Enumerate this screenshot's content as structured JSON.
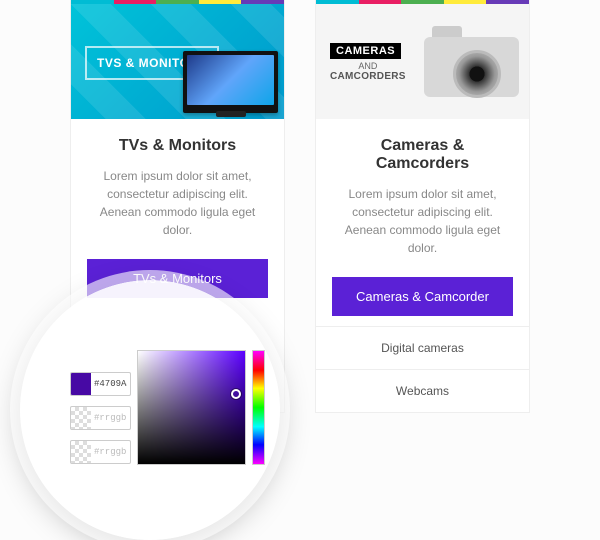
{
  "cards": [
    {
      "hero_label": "TVS & MONITORS",
      "title": "TVs & Monitors",
      "desc": "Lorem ipsum dolor sit amet, consectetur adipiscing elit. Aenean commodo ligula eget dolor.",
      "button": "TVs & Monitors"
    },
    {
      "hero_label_top": "CAMERAS",
      "hero_label_mid": "AND",
      "hero_label_bot": "CAMCORDERS",
      "title": "Cameras & Camcorders",
      "desc": "Lorem ipsum dolor sit amet, consectetur adipiscing elit. Aenean commodo ligula eget dolor.",
      "button": "Cameras & Camcorder",
      "links": [
        "Digital cameras",
        "Webcams"
      ]
    }
  ],
  "picker": {
    "value": "#4709A4",
    "placeholder": "#rrggbb",
    "accent": "#5b21d6"
  }
}
